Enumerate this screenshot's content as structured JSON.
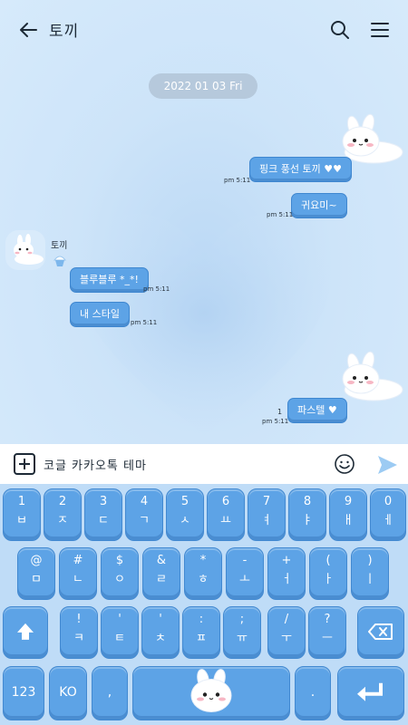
{
  "header": {
    "title": "토끼",
    "back_icon": "arrow-left-icon",
    "search_icon": "search-icon",
    "menu_icon": "hamburger-menu-icon"
  },
  "chat": {
    "date": "2022 01 03 Fri",
    "sender_name": "토끼",
    "messages": [
      {
        "side": "right",
        "text": "핑크 풍선 토끼 ♥♥",
        "time": "pm 5:11"
      },
      {
        "side": "right",
        "text": "귀요미~",
        "time": "pm 5:11"
      },
      {
        "side": "left",
        "text": "블루블루 *_*!",
        "time": "pm 5:11"
      },
      {
        "side": "left",
        "text": "내 스타일",
        "time": "pm 5:11"
      },
      {
        "side": "right",
        "text": "파스텔 ♥",
        "time": "pm 5:11",
        "unread": "1"
      }
    ]
  },
  "input": {
    "value": "코글 카카오톡 테마",
    "plus_icon": "plus-box-icon",
    "emoji_icon": "smiley-icon",
    "send_icon": "send-arrow-icon"
  },
  "keyboard": {
    "row1": [
      {
        "top": "1",
        "bot": "ㅂ"
      },
      {
        "top": "2",
        "bot": "ㅈ"
      },
      {
        "top": "3",
        "bot": "ㄷ"
      },
      {
        "top": "4",
        "bot": "ㄱ"
      },
      {
        "top": "5",
        "bot": "ㅅ"
      },
      {
        "top": "6",
        "bot": "ㅛ"
      },
      {
        "top": "7",
        "bot": "ㅕ"
      },
      {
        "top": "8",
        "bot": "ㅑ"
      },
      {
        "top": "9",
        "bot": "ㅐ"
      },
      {
        "top": "0",
        "bot": "ㅔ"
      }
    ],
    "row2": [
      {
        "top": "@",
        "bot": "ㅁ"
      },
      {
        "top": "#",
        "bot": "ㄴ"
      },
      {
        "top": "$",
        "bot": "ㅇ"
      },
      {
        "top": "&",
        "bot": "ㄹ"
      },
      {
        "top": "*",
        "bot": "ㅎ"
      },
      {
        "top": "-",
        "bot": "ㅗ"
      },
      {
        "top": "+",
        "bot": "ㅓ"
      },
      {
        "top": "(",
        "bot": "ㅏ"
      },
      {
        "top": ")",
        "bot": "ㅣ"
      }
    ],
    "row3": [
      {
        "top": "!",
        "bot": "ㅋ"
      },
      {
        "top": "'",
        "bot": "ㅌ"
      },
      {
        "top": "'",
        "bot": "ㅊ"
      },
      {
        "top": ":",
        "bot": "ㅍ"
      },
      {
        "top": ";",
        "bot": "ㅠ"
      },
      {
        "top": "/",
        "bot": "ㅜ"
      },
      {
        "top": "?",
        "bot": "ㅡ"
      }
    ],
    "shift_icon": "shift-arrow-icon",
    "backspace_icon": "backspace-icon",
    "numbers_label": "123",
    "lang_label": "KO",
    "comma_label": ",",
    "period_label": ".",
    "space_icon": "bunny-icon",
    "enter_icon": "enter-icon"
  },
  "colors": {
    "bubble": "#5da3e6",
    "key": "#5da3e6",
    "keyboard_bg": "#bfdcf7",
    "chat_bg": "#cde4f9"
  }
}
